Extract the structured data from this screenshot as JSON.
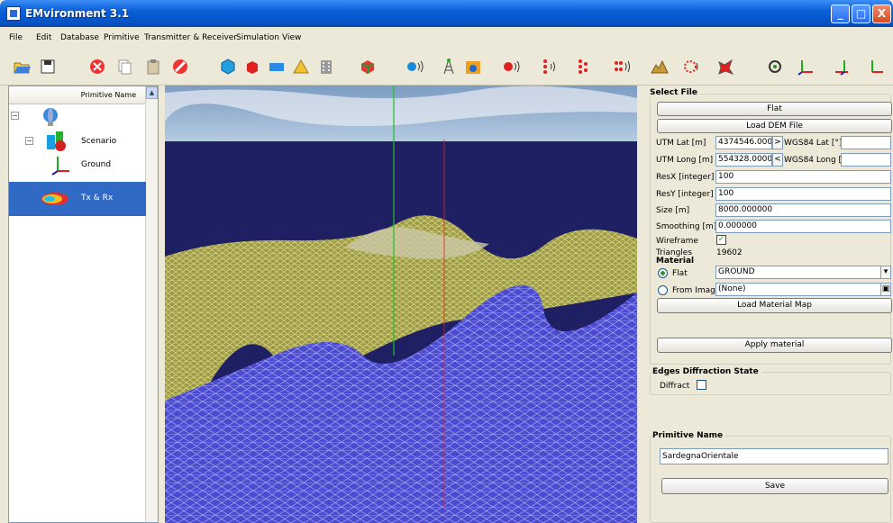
{
  "window": {
    "title": "EMvironment 3.1",
    "minimize": "_",
    "maximize": "□",
    "close": "X"
  },
  "menu": [
    "File",
    "Edit",
    "Database",
    "Primitive",
    "Transmitter & Receiver",
    "Simulation",
    "View"
  ],
  "tree": {
    "header": "Primitive Name",
    "items": [
      {
        "label": "",
        "icon": "root-icon"
      },
      {
        "label": "Scenario",
        "icon": "scenario-icon"
      },
      {
        "label": "Ground",
        "icon": "axes-icon"
      },
      {
        "label": "Tx & Rx",
        "icon": "radiation-pattern-icon",
        "selected": true
      }
    ]
  },
  "props": {
    "select_file": {
      "title": "Select File",
      "flat_button": "Flat",
      "load_dem_button": "Load DEM File",
      "utm_lat_label": "UTM Lat [m]",
      "utm_lat_value": "4374546.00000",
      "to_wgs_arrow": ">",
      "wgs_lat_label": "WGS84 Lat [°]",
      "wgs_lat_value": "",
      "utm_long_label": "UTM Long [m]",
      "utm_long_value": "554328.000000",
      "to_utm_arrow": "<",
      "wgs_long_label": "WGS84 Long [°]",
      "wgs_long_value": "",
      "resx_label": "ResX [integer]",
      "resx_value": "100",
      "resy_label": "ResY [integer]",
      "resy_value": "100",
      "size_label": "Size [m]",
      "size_value": "8000.000000",
      "smoothing_label": "Smoothing [m]",
      "smoothing_value": "0.000000",
      "wireframe_label": "Wireframe",
      "wireframe_checked": true,
      "triangles_label": "Triangles",
      "triangles_value": "19602"
    },
    "material": {
      "title": "Material",
      "flat_label": "Flat",
      "flat_value": "GROUND",
      "from_image_label": "From Image",
      "from_image_value": "(None)",
      "load_map_button": "Load Material Map",
      "apply_button": "Apply material"
    },
    "edges": {
      "title": "Edges Diffraction State",
      "diffract_label": "Diffract",
      "diffract_checked": false
    },
    "primitive": {
      "title": "Primitive Name",
      "name_value": "SardegnaOrientale",
      "save_button": "Save"
    }
  },
  "colors": {
    "titlebar": "#0a5fd8",
    "selection": "#316ac5",
    "sea": "#4b4bd2",
    "land": "#c8b864",
    "sky": "#9dbad8"
  }
}
